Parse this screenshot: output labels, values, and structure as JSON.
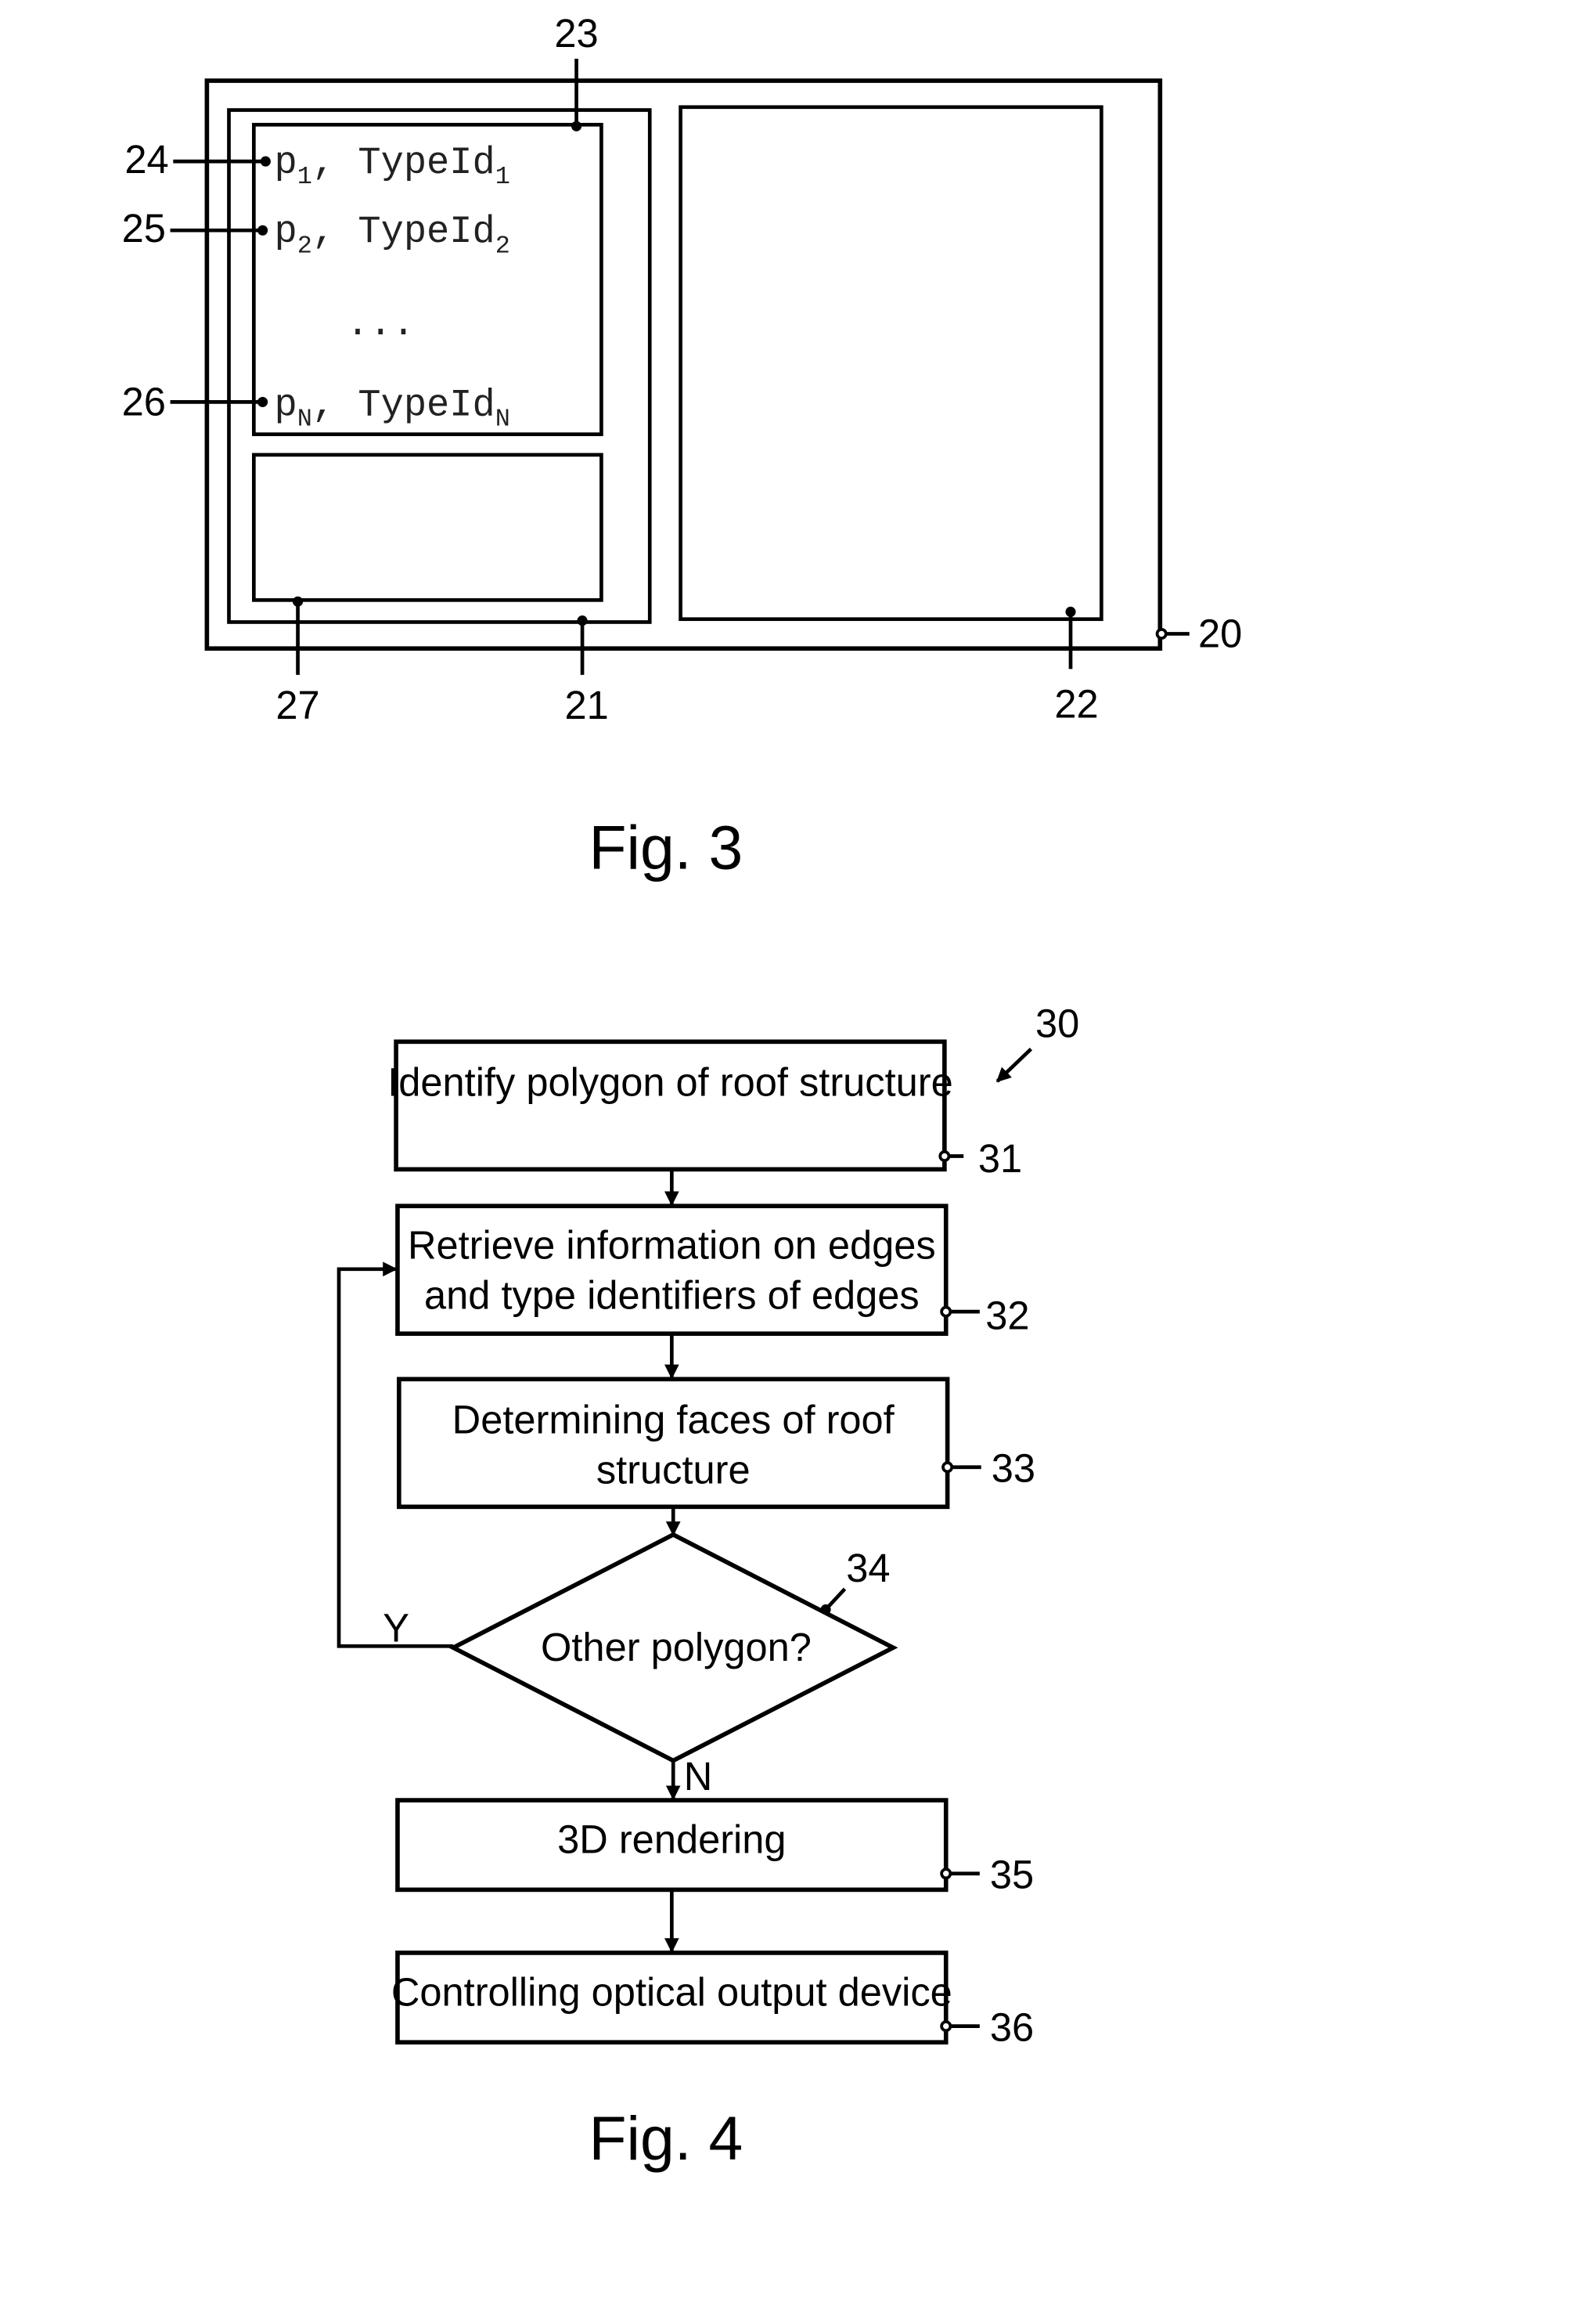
{
  "fig3": {
    "caption": "Fig. 3",
    "labels": {
      "r20": "20",
      "r21": "21",
      "r22": "22",
      "r23": "23",
      "r24": "24",
      "r25": "25",
      "r26": "26",
      "r27": "27"
    },
    "entries": [
      {
        "p": "p",
        "p_sub": "1",
        "type": "TypeId",
        "type_sub": "1"
      },
      {
        "p": "p",
        "p_sub": "2",
        "type": "TypeId",
        "type_sub": "2"
      },
      {
        "p": "p",
        "p_sub": "N",
        "type": "TypeId",
        "type_sub": "N"
      }
    ],
    "ellipsis": "..."
  },
  "fig4": {
    "caption": "Fig. 4",
    "ref": "30",
    "steps": [
      {
        "ref": "31",
        "lines": [
          "Identify polygon of roof structure"
        ]
      },
      {
        "ref": "32",
        "lines": [
          "Retrieve information on edges",
          "and type identifiers of edges"
        ]
      },
      {
        "ref": "33",
        "lines": [
          "Determining faces of roof",
          "structure"
        ]
      },
      {
        "ref": "34",
        "lines": [
          "Other polygon?"
        ]
      },
      {
        "ref": "35",
        "lines": [
          "3D rendering"
        ]
      },
      {
        "ref": "36",
        "lines": [
          "Controlling optical output device"
        ]
      }
    ],
    "yes_label": "Y",
    "no_label": "N"
  }
}
